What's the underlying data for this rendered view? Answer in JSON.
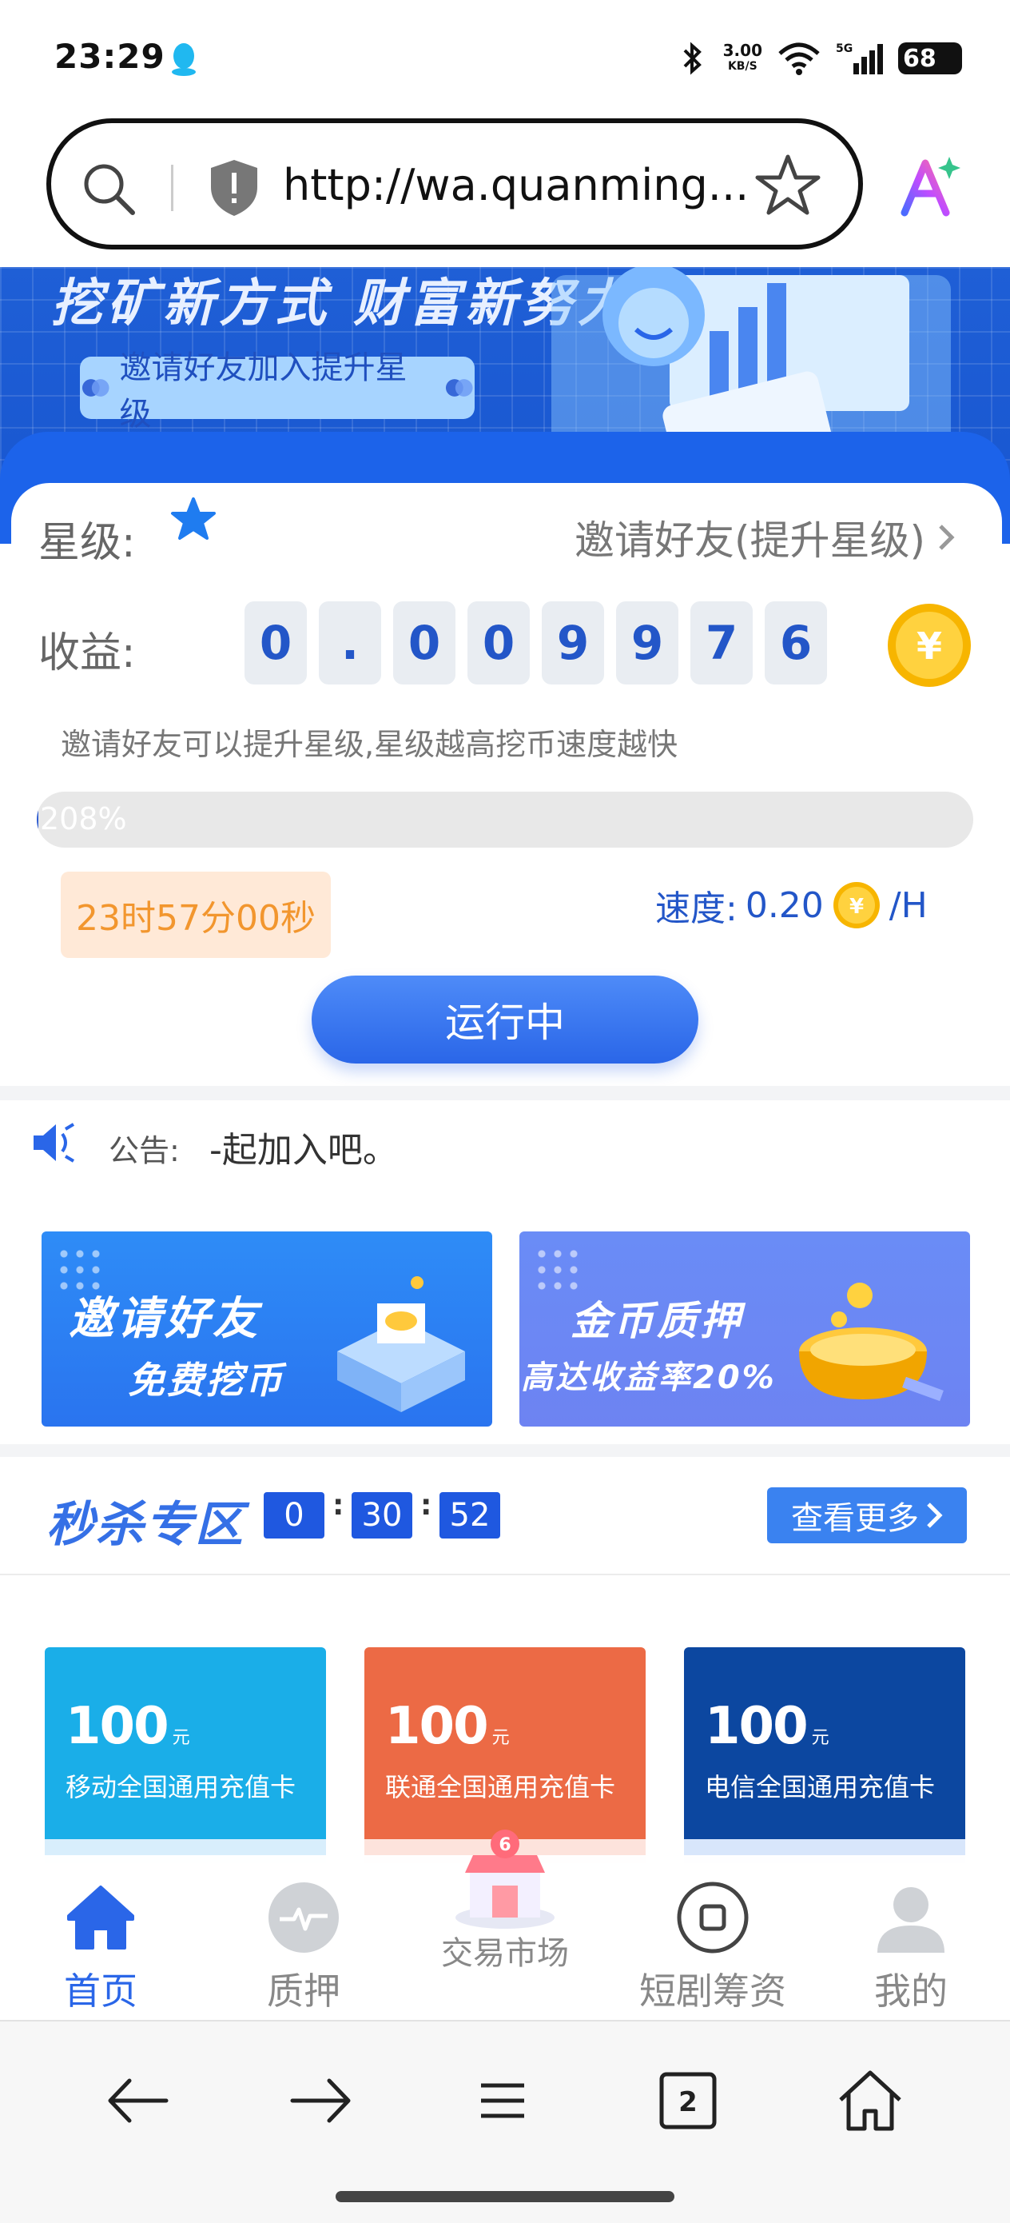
{
  "status_bar": {
    "time": "23:29",
    "net_speed": "3.00",
    "net_speed_unit": "KB/S",
    "signal": "5G",
    "battery": "68"
  },
  "address_bar": {
    "url": "http://wa.quanming..."
  },
  "banner": {
    "slogan": "挖矿新方式 财富新努力",
    "pill_label": "邀请好友加入提升星级"
  },
  "mining": {
    "star_label": "星级:",
    "invite_link": "邀请好友(提升星级)",
    "income_label": "收益:",
    "income_digits": [
      "0",
      ".",
      "0",
      "0",
      "9",
      "9",
      "7",
      "6"
    ],
    "tip": "邀请好友可以提升星级,星级越高挖币速度越快",
    "progress_text": "208%",
    "progress_fraction": 0.0,
    "countdown": "23时57分00秒",
    "speed_label": "速度:",
    "speed_value": "0.20",
    "speed_unit": "/H",
    "run_button": "运行中"
  },
  "notice": {
    "label": "公告:",
    "text": "-起加入吧。"
  },
  "promos": [
    {
      "line1": "邀请好友",
      "line2": "免费挖币"
    },
    {
      "line1": "金币质押",
      "line2": "高达收益率20%"
    }
  ],
  "flash_sale": {
    "title": "秒杀专区",
    "countdown": [
      "0",
      "30",
      "52"
    ],
    "more_label": "查看更多"
  },
  "recharge_cards": [
    {
      "amount": "100",
      "unit": "元",
      "name": "移动全国通用充值卡",
      "color": "#1aaee8",
      "bottom": "#d8eefc"
    },
    {
      "amount": "100",
      "unit": "元",
      "name": "联通全国通用充值卡",
      "color": "#ec6a45",
      "bottom": "#fde3dc"
    },
    {
      "amount": "100",
      "unit": "元",
      "name": "电信全国通用充值卡",
      "color": "#0c47a0",
      "bottom": "#d8e6fb"
    }
  ],
  "app_nav": {
    "items": [
      {
        "label": "首页",
        "icon": "home-icon",
        "active": true
      },
      {
        "label": "质押",
        "icon": "pulse-icon",
        "active": false
      },
      {
        "label": "交易市场",
        "icon": "shop-icon",
        "active": false
      },
      {
        "label": "短剧筹资",
        "icon": "square-circle-icon",
        "active": false
      },
      {
        "label": "我的",
        "icon": "user-icon",
        "active": false
      }
    ]
  },
  "browser_nav": {
    "tabs_count": "2"
  },
  "colors": {
    "accent": "#2a66e8",
    "orange": "#f2962e",
    "banner": "#1f5fd6"
  }
}
